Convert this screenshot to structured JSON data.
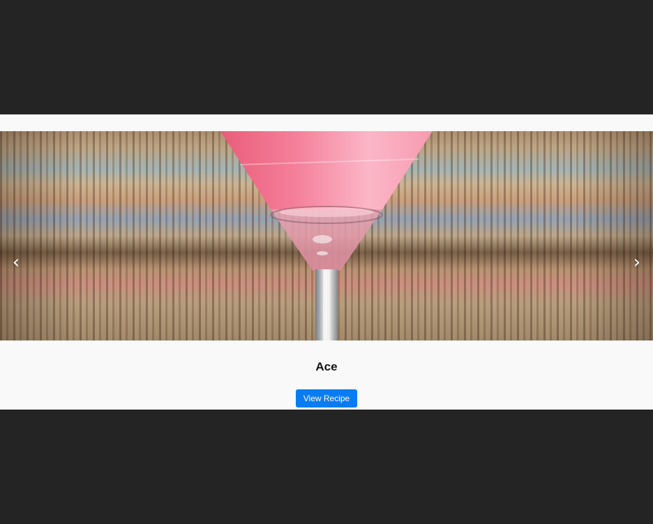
{
  "carousel": {
    "prev_glyph": "‹",
    "next_glyph": "›",
    "slide": {
      "title": "Ace",
      "button_label": "View Recipe",
      "image_subject": "pink cocktail in martini glass"
    }
  },
  "colors": {
    "page_background": "#242424",
    "carousel_background": "#f9f9f9",
    "button_background": "#0a7cf2",
    "button_text": "#ffffff",
    "drink_pink": "#f58fa6"
  },
  "icons": {
    "prev": "chevron-left-icon",
    "next": "chevron-right-icon"
  }
}
